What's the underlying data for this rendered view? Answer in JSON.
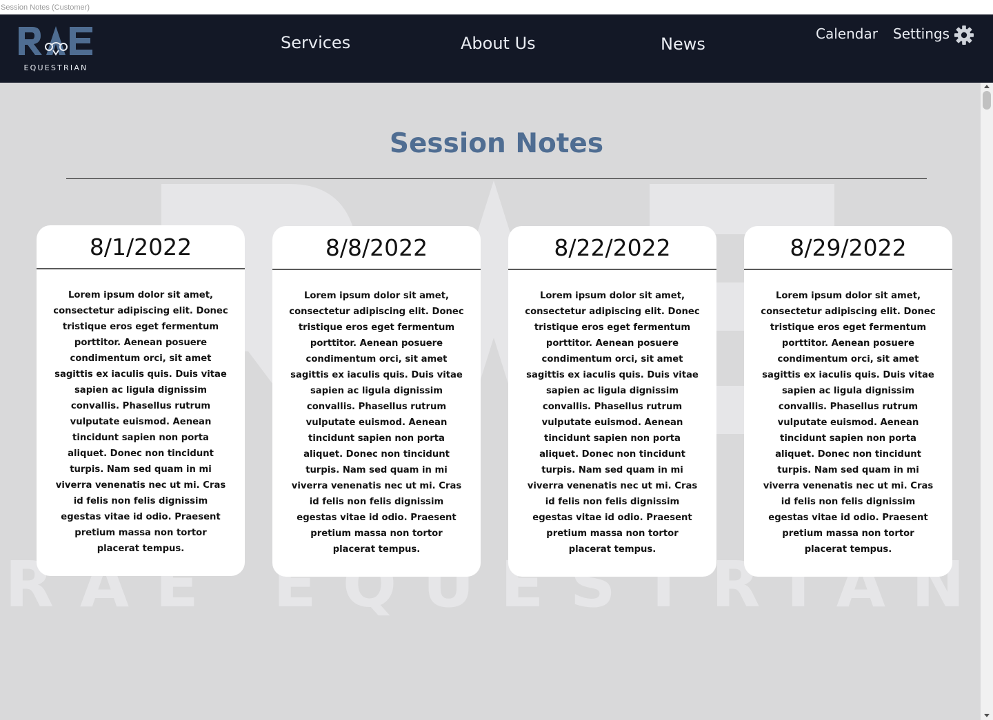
{
  "window": {
    "title": "Session Notes (Customer)"
  },
  "brand": {
    "logo_letters": "RAE",
    "logo_word": "EQUESTRIAN"
  },
  "nav": {
    "services": "Services",
    "about": "About Us",
    "news": "News",
    "calendar": "Calendar",
    "settings": "Settings",
    "settings_icon": "gear-icon"
  },
  "page": {
    "title": "Session Notes"
  },
  "watermark": {
    "text": "RAE EQUESTRIAN"
  },
  "cards": [
    {
      "date": "8/1/2022",
      "notes": "Lorem ipsum dolor sit amet, consectetur adipiscing elit. Donec tristique eros eget fermentum porttitor. Aenean posuere condimentum orci, sit amet sagittis ex iaculis quis. Duis vitae sapien ac ligula dignissim convallis. Phasellus rutrum vulputate euismod. Aenean tincidunt sapien non porta aliquet. Donec non tincidunt turpis. Nam sed quam in mi viverra venenatis nec ut mi. Cras id felis non felis dignissim egestas vitae id odio. Praesent pretium massa non tortor placerat tempus."
    },
    {
      "date": "8/8/2022",
      "notes": "Lorem ipsum dolor sit amet, consectetur adipiscing elit. Donec tristique eros eget fermentum porttitor. Aenean posuere condimentum orci, sit amet sagittis ex iaculis quis. Duis vitae sapien ac ligula dignissim convallis. Phasellus rutrum vulputate euismod. Aenean tincidunt sapien non porta aliquet. Donec non tincidunt turpis. Nam sed quam in mi viverra venenatis nec ut mi. Cras id felis non felis dignissim egestas vitae id odio. Praesent pretium massa non tortor placerat tempus."
    },
    {
      "date": "8/22/2022",
      "notes": "Lorem ipsum dolor sit amet, consectetur adipiscing elit. Donec tristique eros eget fermentum porttitor. Aenean posuere condimentum orci, sit amet sagittis ex iaculis quis. Duis vitae sapien ac ligula dignissim convallis. Phasellus rutrum vulputate euismod. Aenean tincidunt sapien non porta aliquet. Donec non tincidunt turpis. Nam sed quam in mi viverra venenatis nec ut mi. Cras id felis non felis dignissim egestas vitae id odio. Praesent pretium massa non tortor placerat tempus."
    },
    {
      "date": "8/29/2022",
      "notes": "Lorem ipsum dolor sit amet, consectetur adipiscing elit. Donec tristique eros eget fermentum porttitor. Aenean posuere condimentum orci, sit amet sagittis ex iaculis quis. Duis vitae sapien ac ligula dignissim convallis. Phasellus rutrum vulputate euismod. Aenean tincidunt sapien non porta aliquet. Donec non tincidunt turpis. Nam sed quam in mi viverra venenatis nec ut mi. Cras id felis non felis dignissim egestas vitae id odio. Praesent pretium massa non tortor placerat tempus."
    }
  ],
  "colors": {
    "navbar": "#131826",
    "accent": "#4f6d92",
    "background": "#d9d9da",
    "card": "#ffffff"
  }
}
